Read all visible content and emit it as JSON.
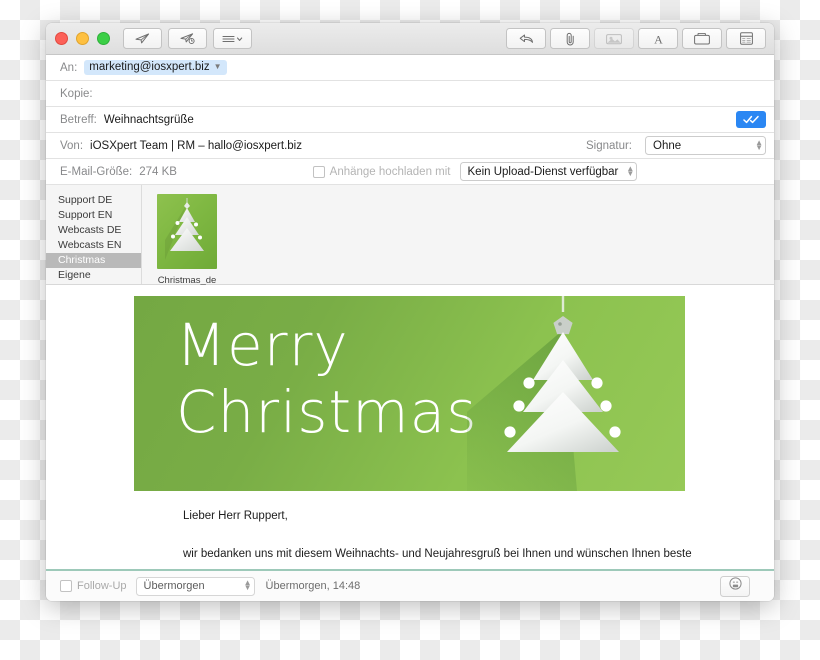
{
  "window": {
    "traffic_lights": [
      "close",
      "minimize",
      "zoom"
    ],
    "toolbar_left": [
      {
        "name": "send-now-button",
        "icon": "paper-plane-icon",
        "label": "Senden"
      },
      {
        "name": "send-later-button",
        "icon": "paper-plane-clock-icon",
        "label": "Später senden"
      },
      {
        "name": "options-menu-button",
        "icon": "list-chevron-icon",
        "label": "Optionen"
      }
    ],
    "toolbar_right": [
      {
        "name": "reply-button",
        "icon": "reply-arrow-icon",
        "label": "Antworten"
      },
      {
        "name": "attach-button",
        "icon": "paperclip-icon",
        "label": "Anhang"
      },
      {
        "name": "photo-browser-button",
        "icon": "photo-icon",
        "label": "Fotos",
        "disabled": true
      },
      {
        "name": "format-button",
        "icon": "letter-a-icon",
        "label": "Format"
      },
      {
        "name": "stationery-button",
        "icon": "stationery-icon",
        "label": "Briefpapier"
      },
      {
        "name": "template-button",
        "icon": "template-icon",
        "label": "Vorlage"
      }
    ]
  },
  "header": {
    "to": {
      "label": "An:",
      "recipient": "marketing@iosxpert.biz"
    },
    "cc": {
      "label": "Kopie:",
      "value": ""
    },
    "subject": {
      "label": "Betreff:",
      "value": "Weihnachtsgrüße"
    },
    "from": {
      "label": "Von:",
      "value": "iOSXpert Team | RM – hallo@iosxpert.biz"
    },
    "signature": {
      "label": "Signatur:",
      "value": "Ohne"
    },
    "size": {
      "label": "E-Mail-Größe:",
      "value": "274 KB"
    },
    "upload": {
      "checkbox_label": "Anhänge hochladen mit",
      "service": "Kein Upload-Dienst verfügbar",
      "checked": false
    },
    "send_confirm_icon": "double-check-icon"
  },
  "chooser": {
    "categories": [
      {
        "label": "Support DE",
        "selected": false
      },
      {
        "label": "Support EN",
        "selected": false
      },
      {
        "label": "Webcasts DE",
        "selected": false
      },
      {
        "label": "Webcasts EN",
        "selected": false
      },
      {
        "label": "Christmas",
        "selected": true
      },
      {
        "label": "Eigene",
        "selected": false
      }
    ],
    "templates": [
      {
        "caption": "Christmas_de",
        "icon": "christmas-tree-thumbnail"
      }
    ]
  },
  "message": {
    "banner": {
      "line1": "Merry",
      "line2": "Christmas",
      "background_color": "#7fb343",
      "art": "christmas-tree-illustration"
    },
    "salutation": "Lieber Herr Ruppert,",
    "paragraph": "wir bedanken uns mit diesem Weihnachts- und Neujahresgruß bei Ihnen und wünschen Ihnen beste Gesundheit, viel Glück, ein schönes neues Jahr sowie eine besinnliche Weihnachtszeit. Viel Erfolg im"
  },
  "bottom_bar": {
    "follow_up_label": "Follow-Up",
    "follow_up_checked": false,
    "follow_up_value": "Übermorgen",
    "follow_up_when": "Übermorgen, 14:48",
    "emoji_button_icon": "smiley-icon",
    "accent_color": "#9dc9b9"
  }
}
